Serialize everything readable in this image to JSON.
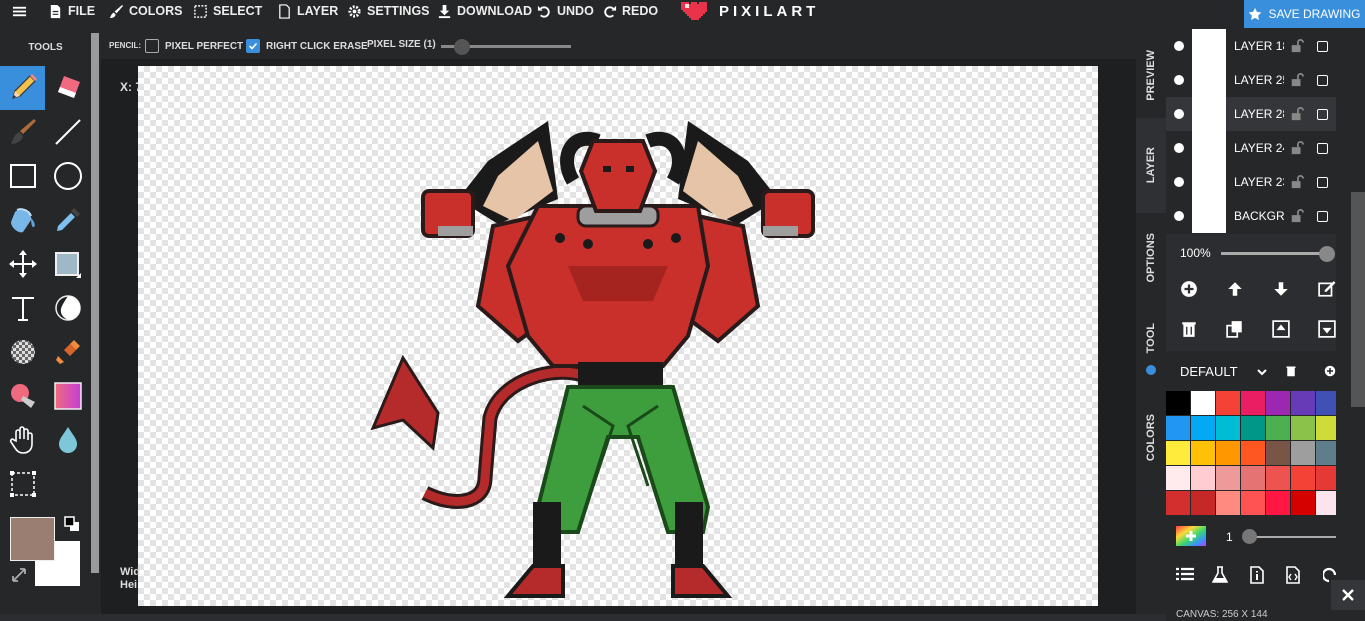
{
  "menu": {
    "file": "FILE",
    "colors": "COLORS",
    "select": "SELECT",
    "layer": "LAYER",
    "settings": "SETTINGS",
    "download": "DOWNLOAD",
    "undo": "UNDO",
    "redo": "REDO"
  },
  "brand": {
    "logo_text": "PIXILART",
    "logo_color": "#e8334a"
  },
  "save_button": {
    "label": "SAVE DRAWING",
    "color": "#3a8fdc"
  },
  "tools": {
    "title": "TOOLS",
    "items": [
      "pencil",
      "eraser",
      "brush",
      "line",
      "rectangle",
      "circle",
      "fill-bucket",
      "eyedropper",
      "move",
      "select",
      "text",
      "dither",
      "pattern",
      "stamp",
      "color-replace",
      "gradient",
      "hand",
      "blur",
      "crop"
    ],
    "active": "pencil",
    "primary_color": "#9a7e72",
    "secondary_color": "#ffffff"
  },
  "options": {
    "tool_label": "PENCIL:",
    "pixel_perfect": {
      "label": "PIXEL PERFECT",
      "checked": false
    },
    "right_click_erase": {
      "label": "RIGHT CLICK ERASE",
      "checked": true
    },
    "pixel_size_label": "PIXEL SIZE (1)",
    "pixel_size": 1
  },
  "canvas": {
    "coords_text": "X: 7",
    "width_text": "Wid",
    "height_text": "Hei"
  },
  "side_tabs": [
    "PREVIEW",
    "LAYER",
    "OPTIONS",
    "TOOL",
    "COLORS"
  ],
  "layers": [
    {
      "name": "LAYER 18",
      "active": false
    },
    {
      "name": "LAYER 25",
      "active": false
    },
    {
      "name": "LAYER 28",
      "active": true
    },
    {
      "name": "LAYER 24",
      "active": false
    },
    {
      "name": "LAYER 23",
      "active": false
    },
    {
      "name": "BACKGROUND",
      "active": false
    }
  ],
  "layer_controls": {
    "opacity_label": "100%",
    "opacity": 1.0
  },
  "palette": {
    "name": "DEFAULT",
    "colors": [
      "#000000",
      "#ffffff",
      "#f44336",
      "#e91e63",
      "#9c27b0",
      "#673ab7",
      "#3f51b5",
      "#2196f3",
      "#03a9f4",
      "#00bcd4",
      "#009688",
      "#4caf50",
      "#8bc34a",
      "#cddc39",
      "#ffeb3b",
      "#ffc107",
      "#ff9800",
      "#ff5722",
      "#795548",
      "#9e9e9e",
      "#607d8b",
      "#ffebee",
      "#ffcdd2",
      "#ef9a9a",
      "#e57373",
      "#ef5350",
      "#f44336",
      "#e53935",
      "#d32f2f",
      "#c62828",
      "#ff8a80",
      "#ff5252",
      "#ff1744",
      "#d50000",
      "#fce4ec",
      "#f8bbd0",
      "#f48fb1",
      "#f06292",
      "#ec407a",
      "#e91e63",
      "#d81b60",
      "#c2185b"
    ]
  },
  "brush_controls": {
    "size_label": "1",
    "size": 1,
    "canvas_info": "CANVAS: 256 X 144"
  }
}
